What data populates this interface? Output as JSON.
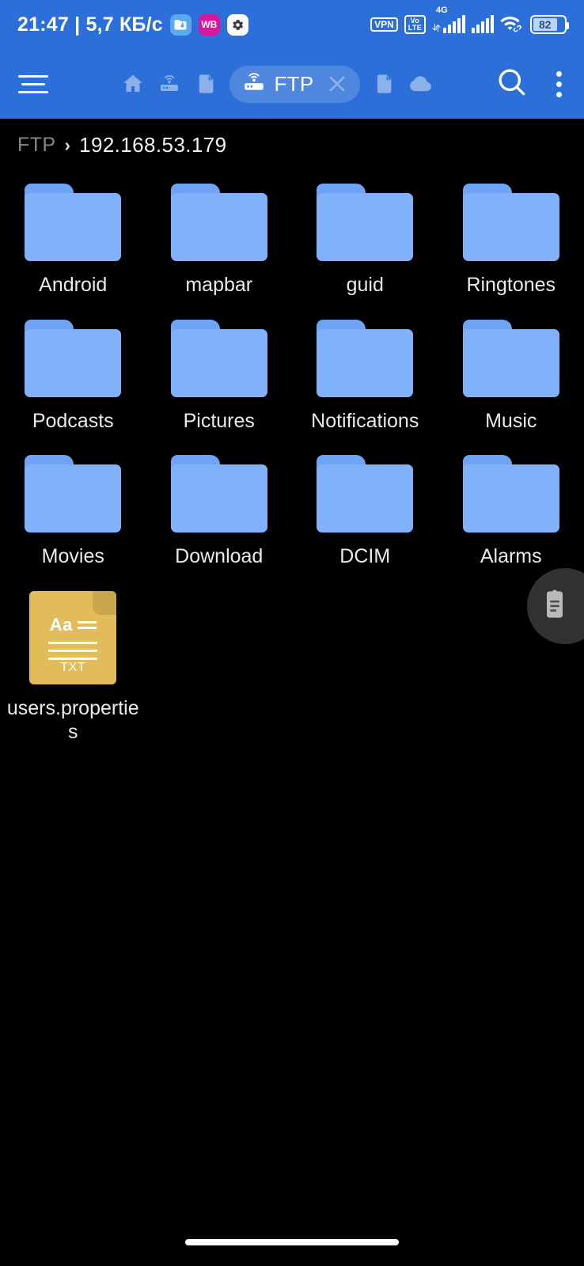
{
  "statusbar": {
    "clock": "21:47",
    "separator": "|",
    "netspeed": "5,7 КБ/с",
    "app_icons": [
      {
        "name": "es-file-explorer-icon",
        "label": ""
      },
      {
        "name": "wb-app-icon",
        "label": "WB"
      },
      {
        "name": "settings-gear-icon",
        "label": ""
      }
    ],
    "vpn_label": "VPN",
    "volte_top": "Vo",
    "volte_bottom": "LTE",
    "network_type": "4G",
    "battery_level": "82"
  },
  "toolbar": {
    "menu_label": "Menu",
    "tabs_left": [
      "home-tab",
      "ftp-tab-inactive",
      "sdcard-tab"
    ],
    "active_tab": {
      "label": "FTP",
      "icon": "router-icon",
      "close_label": "×"
    },
    "tabs_right": [
      "sdcard-tab-2",
      "cloud-tab"
    ],
    "search_label": "Search",
    "overflow_label": "More options"
  },
  "breadcrumb": {
    "root": "FTP",
    "separator": "›",
    "current": "192.168.53.179"
  },
  "grid": {
    "items": [
      {
        "name": "Android",
        "type": "folder"
      },
      {
        "name": "mapbar",
        "type": "folder"
      },
      {
        "name": "guid",
        "type": "folder"
      },
      {
        "name": "Ringtones",
        "type": "folder"
      },
      {
        "name": "Podcasts",
        "type": "folder"
      },
      {
        "name": "Pictures",
        "type": "folder"
      },
      {
        "name": "Notifications",
        "type": "folder"
      },
      {
        "name": "Music",
        "type": "folder"
      },
      {
        "name": "Movies",
        "type": "folder"
      },
      {
        "name": "Download",
        "type": "folder"
      },
      {
        "name": "DCIM",
        "type": "folder"
      },
      {
        "name": "Alarms",
        "type": "folder"
      },
      {
        "name": "users.properties",
        "type": "txt",
        "ext_label": "TXT",
        "glyph": "Aa"
      }
    ]
  },
  "fab": {
    "name": "clipboard-button"
  },
  "colors": {
    "toolbar_blue": "#2c6fd9",
    "folder_blue": "#82b1fb",
    "folder_tab_blue": "#6fa3f5",
    "txt_amber": "#e2bc5a",
    "background": "#000000",
    "label_text": "#eaeaea"
  }
}
